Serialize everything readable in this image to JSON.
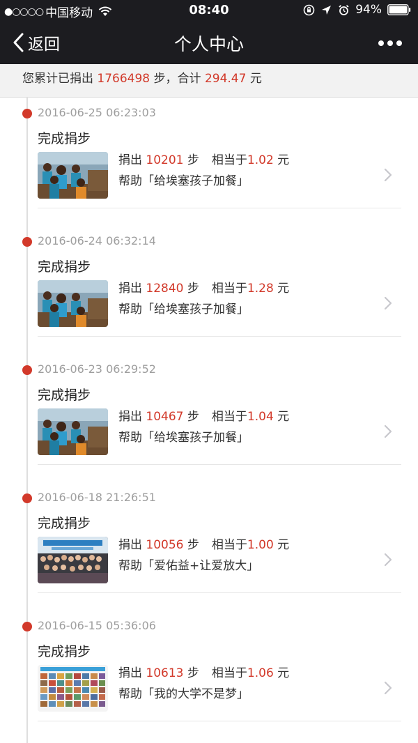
{
  "status_bar": {
    "signal": "●○○○○",
    "carrier": "中国移动",
    "time": "08:40",
    "battery": "94%"
  },
  "nav": {
    "back_label": "返回",
    "title": "个人中心"
  },
  "summary": {
    "prefix": "您累计已捐出",
    "total_steps": "1766498",
    "steps_unit": "步，合计",
    "total_amount": "294.47",
    "amount_unit": "元"
  },
  "entry_labels": {
    "donate": "捐出",
    "step_unit": "步",
    "equivalent": "相当于",
    "yuan": "元"
  },
  "entries": [
    {
      "time": "2016-06-25 06:23:03",
      "title": "完成捐步",
      "steps": "10201",
      "amount": "1.02",
      "help": "帮助「给埃塞孩子加餐」",
      "thumb_icon": "ethiopia-children-photo"
    },
    {
      "time": "2016-06-24 06:32:14",
      "title": "完成捐步",
      "steps": "12840",
      "amount": "1.28",
      "help": "帮助「给埃塞孩子加餐」",
      "thumb_icon": "ethiopia-children-photo"
    },
    {
      "time": "2016-06-23 06:29:52",
      "title": "完成捐步",
      "steps": "10467",
      "amount": "1.04",
      "help": "帮助「给埃塞孩子加餐」",
      "thumb_icon": "ethiopia-children-photo"
    },
    {
      "time": "2016-06-18 21:26:51",
      "title": "完成捐步",
      "steps": "10056",
      "amount": "1.00",
      "help": "帮助「爱佑益+让爱放大」",
      "thumb_icon": "group-photo"
    },
    {
      "time": "2016-06-15 05:36:06",
      "title": "完成捐步",
      "steps": "10613",
      "amount": "1.06",
      "help": "帮助「我的大学不是梦」",
      "thumb_icon": "photo-collage"
    }
  ],
  "colors": {
    "header_bg": "#1c1c20",
    "accent_red": "#d2392a",
    "timestamp_gray": "#9e9e9e"
  }
}
